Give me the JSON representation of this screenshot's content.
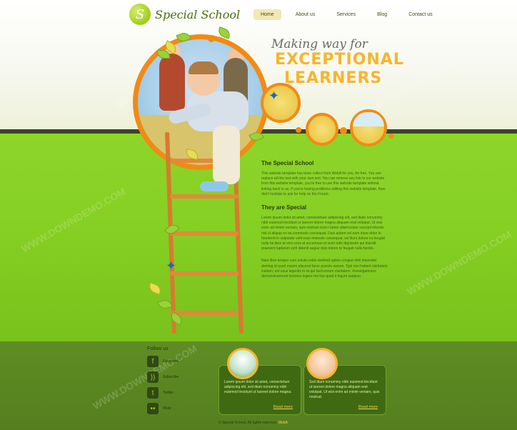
{
  "site": {
    "name": "Special School",
    "logo_char": "S"
  },
  "nav": {
    "items": [
      "Home",
      "About us",
      "Services",
      "Blog",
      "Contact us"
    ],
    "active": "Home"
  },
  "hero": {
    "line1": "Making way for",
    "line2": "EXCEPTIONAL",
    "line3": "LEARNERS"
  },
  "content": {
    "section1_title": "The Special School",
    "section1_text": "This website template has been collect from WebA for you, for free. You can replace all this text with your own text. You can remove any link to our website from this website template, you're free to use this website template without linking back to us. If you're having problems editing this website template, then don't hesitate to ask for help on the Forum.",
    "section2_title": "They are Special",
    "section2_text1": "Lorem ipsum dolor sit amet, consectetuer adipiscing elit, sed diam nonummy nibh euismod tincidunt ut laoreet dolore magna aliquam erat volutpat. Ut wisi enim ad minim veniam, quis nostrud exerci tation ullamcorper suscipit lobortis nisl ut aliquip ex ea commodo consequat. Duis autem vel eum iriure dolor in hendrerit in vulputate velit esse molestie consequat, vel illum dolore eu feugiat nulla facilisis at vero eros et accumsan et iusto odio dignissim qui blandit praesent luptatum zzril delenit augue duis dolore te feugait nulla facilisi.",
    "section2_text2": "Nam liber tempor cum soluta nobis eleifend option congue nihil imperdiet doming id quod mazim placerat facer possim assum. Typi non habent claritatem insitam; est usus legentis in iis qui facit eorum claritatem. Investigationes demonstraverunt lectores legere me lius quod ii legunt saepius."
  },
  "footer": {
    "follow_title": "Follow us",
    "follow_items": [
      {
        "icon": "facebook-icon",
        "glyph": "f",
        "label": "Facebook"
      },
      {
        "icon": "rss-icon",
        "glyph": "))",
        "label": "Subscribe"
      },
      {
        "icon": "twitter-icon",
        "glyph": "t",
        "label": "Twitter"
      },
      {
        "icon": "flickr-icon",
        "glyph": "••",
        "label": "Flickr"
      }
    ],
    "card1_text": "Lorem ipsum dolor sit amet, consectetuer adipiscing elit, sed diam nonummy nibh euismod tincidunt ut laoreet dolore magna.",
    "card2_text": "Sed diam nonummy nibh euismod tincidunt ut laoreet dolore magna aliquam erat volutpat. Ut wisi enim ad minim veniam, quis nostrud.",
    "read_more": "Read more",
    "copyright": "© Special School. All rights reserved.",
    "copyright_link": "WebA"
  },
  "colors": {
    "accent_orange": "#f28a14",
    "accent_yellow": "#f6b52b",
    "green": "#86cf23",
    "footer_green": "#5a8521"
  },
  "watermark": "WWW.DOWNDEMO.COM"
}
